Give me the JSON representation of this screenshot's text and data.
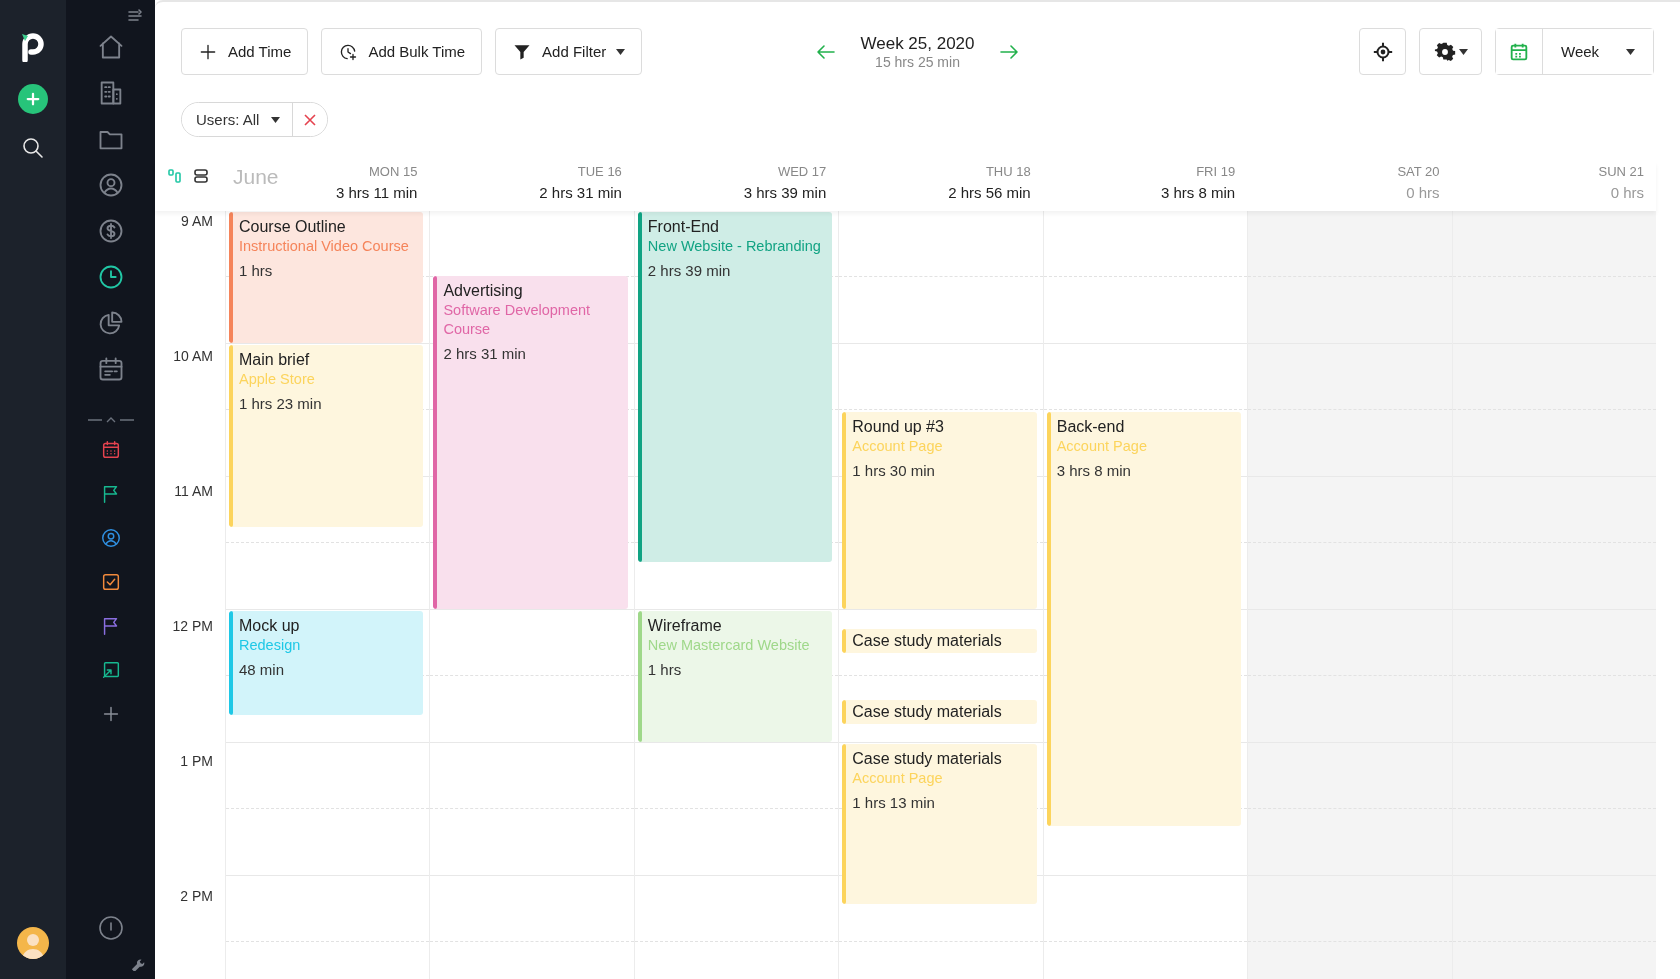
{
  "sidebar": {
    "nav_items": [
      {
        "kind": "home",
        "selected": false
      },
      {
        "kind": "building",
        "selected": false
      },
      {
        "kind": "folder",
        "selected": false
      },
      {
        "kind": "user",
        "selected": false
      },
      {
        "kind": "dollar",
        "selected": false
      },
      {
        "kind": "clock",
        "selected": true
      },
      {
        "kind": "pie",
        "selected": false
      },
      {
        "kind": "calendar",
        "selected": false
      }
    ],
    "shortcuts": [
      {
        "kind": "calendar-small",
        "color": "#e5434f"
      },
      {
        "kind": "flag",
        "color": "#17b890"
      },
      {
        "kind": "user",
        "color": "#2f8fe0"
      },
      {
        "kind": "check-square",
        "color": "#f28a3c"
      },
      {
        "kind": "flag",
        "color": "#8a6ee0"
      },
      {
        "kind": "arrow-square",
        "color": "#17b890"
      },
      {
        "kind": "plus"
      }
    ]
  },
  "toolbar": {
    "buttons": [
      {
        "kind": "add",
        "label": "Add Time",
        "dropdown": false
      },
      {
        "kind": "bulk",
        "label": "Add Bulk Time",
        "dropdown": false
      },
      {
        "kind": "filter",
        "label": "Add Filter",
        "dropdown": true
      }
    ],
    "week": {
      "title": "Week 25, 2020",
      "total": "15 hrs 25 min"
    },
    "view": {
      "label": "Week"
    }
  },
  "filters": [
    {
      "label": "Users: All"
    }
  ],
  "calendar": {
    "month": "June",
    "hours": [
      "9 AM",
      "10 AM",
      "11 AM",
      "12 PM",
      "1 PM",
      "2 PM"
    ],
    "days": [
      {
        "label": "MON 15",
        "total": "3 hrs 11 min",
        "weekend": false,
        "events": [
          {
            "title": "Course Outline",
            "project": "Instructional Video Course",
            "duration": "1 hrs",
            "color": "#f5845a"
          },
          {
            "title": "Main brief",
            "project": "Apple Store",
            "duration": "1 hrs 23 min",
            "color": "#fcd45c"
          },
          {
            "title": "Mock up",
            "project": "Redesign",
            "duration": "48 min",
            "color": "#1ec8e6"
          }
        ]
      },
      {
        "label": "TUE 16",
        "total": "2 hrs 31 min",
        "weekend": false,
        "events": [
          {
            "title": "Advertising",
            "project": "Software Development Course",
            "duration": "2 hrs 31 min",
            "color": "#e066a6"
          }
        ]
      },
      {
        "label": "WED 17",
        "total": "3 hrs 39 min",
        "weekend": false,
        "events": [
          {
            "title": "Front-End",
            "project": "New Website - Rebranding",
            "duration": "2 hrs 39 min",
            "color": "#11a383"
          },
          {
            "title": "Wireframe",
            "project": "New Mastercard Website",
            "duration": "1 hrs",
            "color": "#9fd88a"
          }
        ]
      },
      {
        "label": "THU 18",
        "total": "2 hrs 56 min",
        "weekend": false,
        "events": [
          {
            "title": "Round up #3",
            "project": "Account Page",
            "duration": "1 hrs 30 min",
            "color": "#fcd45c"
          },
          {
            "title": "Case study materials",
            "color": "#fcd45c"
          },
          {
            "title": "Case study materials",
            "color": "#fcd45c"
          },
          {
            "title": "Case study materials",
            "project": "Account Page",
            "duration": "1 hrs 13 min",
            "color": "#fcd45c"
          }
        ]
      },
      {
        "label": "FRI 19",
        "total": "3 hrs 8 min",
        "weekend": false,
        "events": [
          {
            "title": "Back-end",
            "project": "Account Page",
            "duration": "3 hrs 8 min",
            "color": "#fcd45c"
          }
        ]
      },
      {
        "label": "SAT 20",
        "total": "0 hrs",
        "weekend": true
      },
      {
        "label": "SUN 21",
        "total": "0 hrs",
        "weekend": true
      }
    ]
  }
}
